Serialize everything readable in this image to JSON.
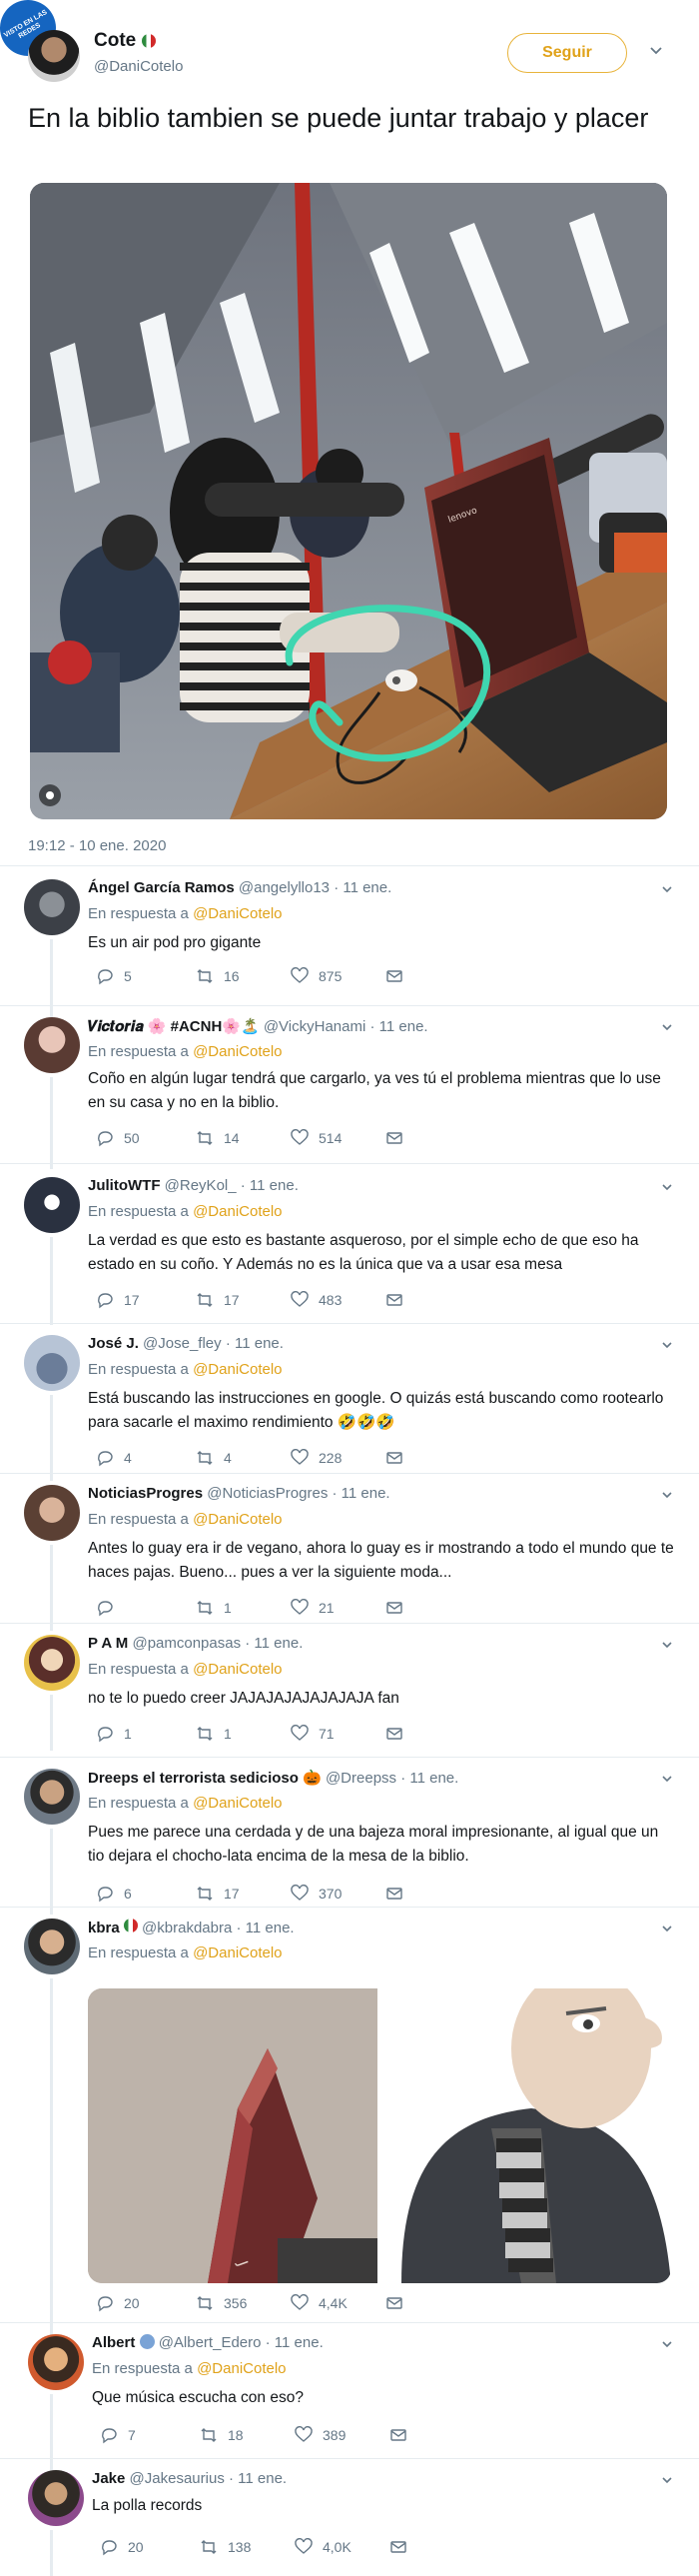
{
  "watermark": "VISTO EN LAS REDES",
  "main_tweet": {
    "name": "Cote",
    "handle": "@DaniCotelo",
    "follow_label": "Seguir",
    "text": "En la biblio tambien se puede juntar trabajo y placer",
    "timestamp": "19:12 - 10 ene. 2020"
  },
  "in_reply_label": "En respuesta a",
  "reply_to": "@DaniCotelo",
  "replies": [
    {
      "name": "Ángel García Ramos",
      "handle": "@angelyllo13",
      "date": "· 11 ene.",
      "text": "Es un air pod pro gigante",
      "replies_count": "5",
      "retweets": "16",
      "likes": "875"
    },
    {
      "name": "𝑽𝒊𝒄𝒕𝒐𝒓𝒊𝒂 🌸 #ACNH🌸🏝️",
      "handle": "@VickyHanami",
      "date": "· 11 ene.",
      "text": "Coño en algún lugar tendrá que cargarlo, ya ves tú el problema mientras que lo use en su casa y no en la biblio.",
      "replies_count": "50",
      "retweets": "14",
      "likes": "514"
    },
    {
      "name": "JulitoWTF",
      "handle": "@ReyKol_",
      "date": "· 11 ene.",
      "text": "La verdad es que esto es bastante asqueroso, por el simple echo de que eso ha estado en su coño. Y Además no es la única que va a usar esa mesa",
      "replies_count": "17",
      "retweets": "17",
      "likes": "483"
    },
    {
      "name": "José J.",
      "handle": "@Jose_fley",
      "date": "· 11 ene.",
      "text": "Está buscando las instrucciones en google. O quizás está buscando como rootearlo para sacarle el maximo rendimiento 🤣🤣🤣",
      "replies_count": "4",
      "retweets": "4",
      "likes": "228"
    },
    {
      "name": "NoticiasProgres",
      "handle": "@NoticiasProgres",
      "date": "· 11 ene.",
      "text": "Antes lo guay era ir de vegano, ahora lo guay es ir mostrando a todo el mundo que te haces pajas. Bueno... pues a ver la siguiente moda...",
      "replies_count": "",
      "retweets": "1",
      "likes": "21"
    },
    {
      "name": "P A M",
      "handle": "@pamconpasas",
      "date": "· 11 ene.",
      "text": "no te lo puedo creer JAJAJAJAJAJAJAJA fan",
      "replies_count": "1",
      "retweets": "1",
      "likes": "71"
    },
    {
      "name": "Dreeps el terrorista sedicioso 🎃",
      "handle": "@Dreepss",
      "date": "· 11 ene.",
      "text": "Pues me parece una cerdada y de una bajeza moral impresionante, al igual que un tio dejara el chocho-lata encima de la mesa de la biblio.",
      "replies_count": "6",
      "retweets": "17",
      "likes": "370"
    },
    {
      "name": "kbra",
      "handle": "@kbrakdabra",
      "date": "· 11 ene.",
      "text": "",
      "replies_count": "20",
      "retweets": "356",
      "likes": "4,4K"
    },
    {
      "name": "Albert",
      "handle": "@Albert_Edero",
      "date": "· 11 ene.",
      "text": "Que música escucha con eso?",
      "replies_count": "7",
      "retweets": "18",
      "likes": "389"
    },
    {
      "name": "Jake",
      "handle": "@Jakesaurius",
      "date": "· 11 ene.",
      "text": "La polla records",
      "replies_count": "20",
      "retweets": "138",
      "likes": "4,0K"
    }
  ],
  "colors": {
    "accent": "#e0a21a",
    "muted": "#657786",
    "divider": "#e6ecf0",
    "highlight_circle": "#3fd6b0"
  },
  "icons": [
    "reply-icon",
    "retweet-icon",
    "like-icon",
    "message-icon",
    "chevron-down-icon"
  ]
}
